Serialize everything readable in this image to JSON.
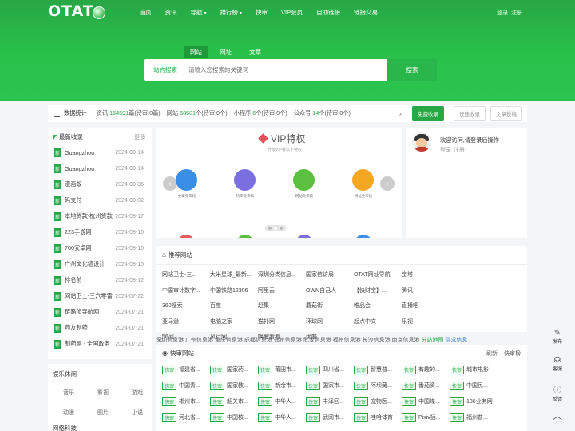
{
  "header": {
    "logo": "OTAT",
    "nav": [
      {
        "label": "首页"
      },
      {
        "label": "资讯"
      },
      {
        "label": "导航",
        "caret": "▾"
      },
      {
        "label": "排行榜",
        "caret": "▾"
      },
      {
        "label": "快审"
      },
      {
        "label": "VIP会员"
      },
      {
        "label": "自助链接"
      },
      {
        "label": "链接交易"
      }
    ],
    "login": "登录",
    "register": "注册"
  },
  "search": {
    "tabs": [
      "网站",
      "网址",
      "文章"
    ],
    "label": "站内搜索",
    "placeholder": "请输入您搜索的关键词",
    "button": "搜索"
  },
  "stats": {
    "title": "数据统计",
    "news_label": "资讯",
    "news_count": "164591",
    "news_suffix": "篇(待审:0篇)",
    "site_label": "网站",
    "site_count": "68501",
    "site_suffix": "个(待审:0个)",
    "mini_label": "小程序",
    "mini_count": "6",
    "mini_suffix": "个(待审:0个)",
    "gzh_label": "公众号",
    "gzh_count": "14",
    "gzh_suffix": "个(待审:0个)",
    "vip_button": "免费收录",
    "fast_button": "快速收录",
    "article_button": "文章投稿"
  },
  "latest": {
    "title": "最新收录",
    "more": "更多",
    "badge": "新",
    "items": [
      {
        "name": "Guangzhou",
        "date": "2024-09-14"
      },
      {
        "name": "Guangzhou",
        "date": "2024-09-14"
      },
      {
        "name": "漫画蚁",
        "date": "2024-09-05"
      },
      {
        "name": "码支付",
        "date": "2024-09-02"
      },
      {
        "name": "本地贷款-杭州贷款",
        "date": "2024-08-17"
      },
      {
        "name": "223手游网",
        "date": "2024-08-16"
      },
      {
        "name": "700安卓网",
        "date": "2024-08-16"
      },
      {
        "name": "广州文化墙设计",
        "date": "2024-08-15"
      },
      {
        "name": "排名前十",
        "date": "2024-08-12"
      },
      {
        "name": "网站卫士-三六零雷",
        "date": "2024-07-22"
      },
      {
        "name": "链路侦导航网",
        "date": "2024-07-21"
      },
      {
        "name": "药友制药",
        "date": "2024-07-21"
      },
      {
        "name": "制药网 - 全国政务",
        "date": "2024-07-21"
      }
    ]
  },
  "leisure": {
    "title": "娱乐休闲",
    "tags": [
      "音乐",
      "影视",
      "游戏",
      "动漫",
      "图片",
      "小说"
    ],
    "next_title": "网络科技"
  },
  "vip": {
    "title": "VIP特权",
    "subtitle": "升级VIP看以下特权",
    "features": [
      {
        "label": "文章免审核",
        "color": "#3a8ee6"
      },
      {
        "label": "快审免审核",
        "color": "#7b6fe0"
      },
      {
        "label": "网站免审核",
        "color": "#5cbf3f"
      },
      {
        "label": "网址免审核",
        "color": "#f5a623"
      }
    ],
    "peek_colors": [
      "#e85a5a",
      "#5cbf3f",
      "#7b6fe0",
      "#3a8ee6"
    ]
  },
  "user": {
    "welcome": "欢迎访问,请登录后操作",
    "login": "登录",
    "register": "注册"
  },
  "recommended": {
    "title": "推荐网站",
    "cells": [
      "网站卫士-三...",
      "大米星球_最新...",
      "深圳分类信息...",
      "国家信访局",
      "OTAT网址导航",
      "中国审计数字...",
      "中国铁路12306",
      "阿里云",
      "OWN自己人",
      "【快财宝】...",
      "360搜索",
      "百度",
      "赶集",
      "蘑菇街",
      "唯品会",
      "亚马逊",
      "电脑之家",
      "猫扑网",
      "环球网",
      "起点中文",
      "56网",
      "风行网",
      "唤醒看看",
      "优酷"
    ],
    "extra": [
      "宝塔",
      "腾讯",
      "直播吧",
      "乐视"
    ]
  },
  "ticker": {
    "text": "深圳信息港 广州信息港 重庆信息港 成都信息港 郑州信息港 武汉信息港 福州信息港 长沙信息港 南京信息港",
    "link1": "分站地图",
    "link2": "供求信息"
  },
  "audit": {
    "title": "快审网站",
    "refresh": "刷新",
    "ranking": "快审榜",
    "badge": "快审",
    "cells": [
      "福建省...",
      "国家药...",
      "莆田市...",
      "四川省...",
      "智慧普...",
      "有趣的...",
      "城市电影",
      "中国青...",
      "国家教...",
      "新余市...",
      "国家市...",
      "阿坝藏...",
      "番茄资...",
      "中国民...",
      "郴州市...",
      "韶关市...",
      "中华人...",
      "丰泽区...",
      "宠物医...",
      "中国煤...",
      "186业务网",
      "河北省...",
      "中国核...",
      "中华人...",
      "武冈市...",
      "哇哈体育",
      "Pixiv插...",
      "福州普..."
    ]
  },
  "sidebar": {
    "publish": "发布",
    "service": "客服",
    "feedback": "反馈"
  }
}
